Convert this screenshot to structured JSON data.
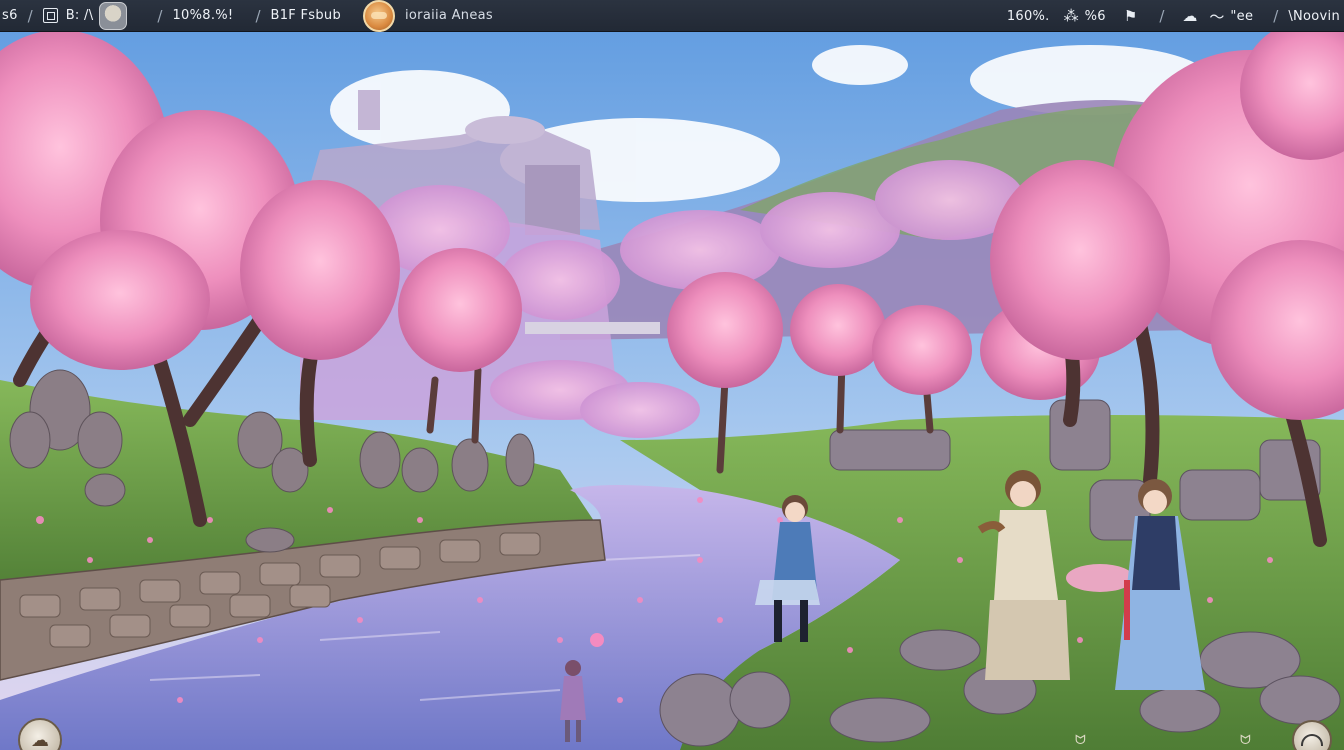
{
  "hud": {
    "left_fragment": "s6",
    "level_text": "B: /\\",
    "stat_text": "10%8.%!",
    "title_text": "B1F Fsbub",
    "currency_text": "ioraiia Aneas",
    "right_stat_1": "160%.",
    "right_stat_2": "%6",
    "right_stat_3": "\"ee",
    "right_stat_4": "\\Noovin"
  },
  "icons": {
    "square_icon": "square-icon",
    "portrait": "portrait-icon",
    "coin": "coin-icon",
    "flag": "flag-icon",
    "cloud": "cloud-icon",
    "wave": "wave-icon",
    "slash": "slash-divider"
  },
  "colors": {
    "sky_top": "#6ea6e0",
    "blossom": "#ef9bc3",
    "grass": "#6fa34a",
    "river": "#8d95d9"
  }
}
